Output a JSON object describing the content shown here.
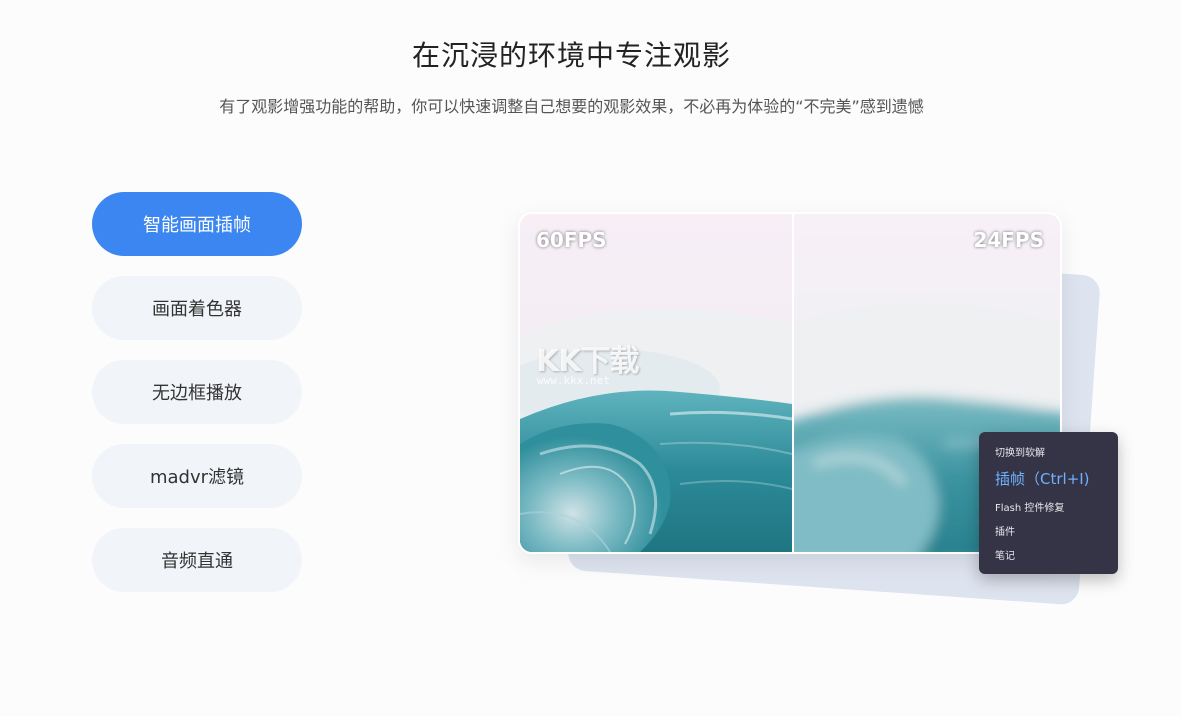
{
  "header": {
    "title": "在沉浸的环境中专注观影",
    "subtitle": "有了观影增强功能的帮助，你可以快速调整自己想要的观影效果，不必再为体验的“不完美”感到遗憾"
  },
  "tabs": [
    {
      "label": "智能画面插帧",
      "active": true
    },
    {
      "label": "画面着色器",
      "active": false
    },
    {
      "label": "无边框播放",
      "active": false
    },
    {
      "label": "madvr滤镜",
      "active": false
    },
    {
      "label": "音频直通",
      "active": false
    }
  ],
  "preview": {
    "left_fps": "60FPS",
    "right_fps": "24FPS",
    "watermark": "KK下载",
    "watermark_url": "www.kkx.net"
  },
  "context_menu": {
    "items": [
      {
        "label": "切换到软解"
      },
      {
        "label": "插帧（Ctrl+I)",
        "highlighted": true
      },
      {
        "label": "Flash 控件修复"
      },
      {
        "label": "插件"
      },
      {
        "label": "笔记"
      }
    ]
  },
  "colors": {
    "accent": "#3b86f0",
    "tab_bg": "#f1f4f8",
    "menu_bg": "#353447",
    "menu_highlight": "#6fb0ff"
  }
}
